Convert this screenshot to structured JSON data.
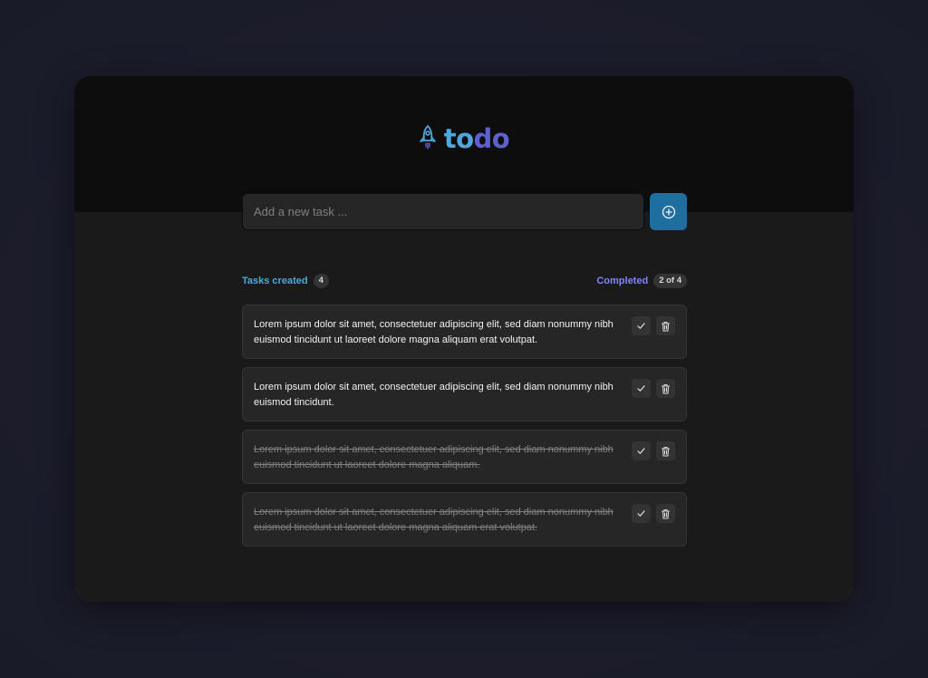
{
  "app": {
    "logo_part1": "to",
    "logo_part2": "do",
    "logo_icon": "rocket-icon"
  },
  "input": {
    "placeholder": "Add a new task ...",
    "value": "",
    "create_icon": "plus-circle-icon"
  },
  "summary": {
    "created_label": "Tasks created",
    "created_count": "4",
    "done_label": "Completed",
    "done_count": "2 of 4"
  },
  "tasks": [
    {
      "text": "Lorem ipsum dolor sit amet, consectetuer adipiscing elit, sed diam nonummy nibh euismod tincidunt ut laoreet dolore magna aliquam erat volutpat.",
      "completed": false
    },
    {
      "text": "Lorem ipsum dolor sit amet, consectetuer adipiscing elit, sed diam nonummy nibh euismod tincidunt.",
      "completed": false
    },
    {
      "text": "Lorem ipsum dolor sit amet, consectetuer adipiscing elit, sed diam nonummy nibh euismod tincidunt ut laoreet dolore magna aliquam.",
      "completed": true
    },
    {
      "text": "Lorem ipsum dolor sit amet, consectetuer adipiscing elit, sed diam nonummy nibh euismod tincidunt ut laoreet dolore magna aliquam erat volutpat.",
      "completed": true
    }
  ],
  "task_action_icons": {
    "complete": "check-icon",
    "delete": "trash-icon"
  },
  "colors": {
    "background": "#1c1d2c",
    "header": "#0d0d0d",
    "body": "#1a1a1a",
    "blue": "#4ea8de",
    "purple": "#5e60ce",
    "purple_light": "#8284fa",
    "button": "#1e6f9f"
  }
}
